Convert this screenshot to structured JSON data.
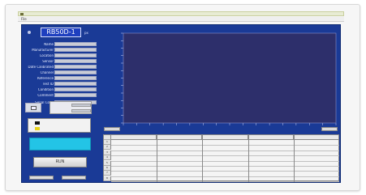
{
  "window": {
    "title": "",
    "menu": [
      "File"
    ]
  },
  "device": {
    "id": "RB50D-1",
    "unit": "px"
  },
  "form": {
    "fields": [
      {
        "label": "Name",
        "value": ""
      },
      {
        "label": "Manufacturer",
        "value": ""
      },
      {
        "label": "Location",
        "value": ""
      },
      {
        "label": "Sensor",
        "value": ""
      },
      {
        "label": "Date Calibrated",
        "value": ""
      },
      {
        "label": "Channel",
        "value": ""
      },
      {
        "label": "Reference",
        "value": ""
      },
      {
        "label": "Test ID",
        "value": ""
      },
      {
        "label": "Condition",
        "value": ""
      },
      {
        "label": "Comment",
        "value": ""
      }
    ],
    "serial_label": "Serial Code",
    "serial_value": ""
  },
  "status": {
    "rows": [
      {
        "label": "",
        "value": ""
      },
      {
        "label": "",
        "value": ""
      }
    ]
  },
  "colorkey": {
    "items": [
      {
        "color": "#111111",
        "label": ""
      },
      {
        "color": "#e8d21a",
        "label": ""
      }
    ]
  },
  "message": "",
  "run_button": "RUN",
  "mini_buttons": [
    "",
    ""
  ],
  "chart_data": {
    "type": "line",
    "title": "",
    "xlabel": "",
    "ylabel": "",
    "series": [],
    "grid": false,
    "background": "#2d2f6b"
  },
  "chart_controls": [
    "",
    ""
  ],
  "table": {
    "columns": [
      "",
      "",
      "",
      "",
      ""
    ],
    "row_labels": [
      "1",
      "2",
      "3",
      "4",
      "5",
      "6",
      "7",
      "8"
    ]
  },
  "colors": {
    "panel": "#1a3a96",
    "plot": "#2d2f6b",
    "message": "#23c4e6"
  }
}
